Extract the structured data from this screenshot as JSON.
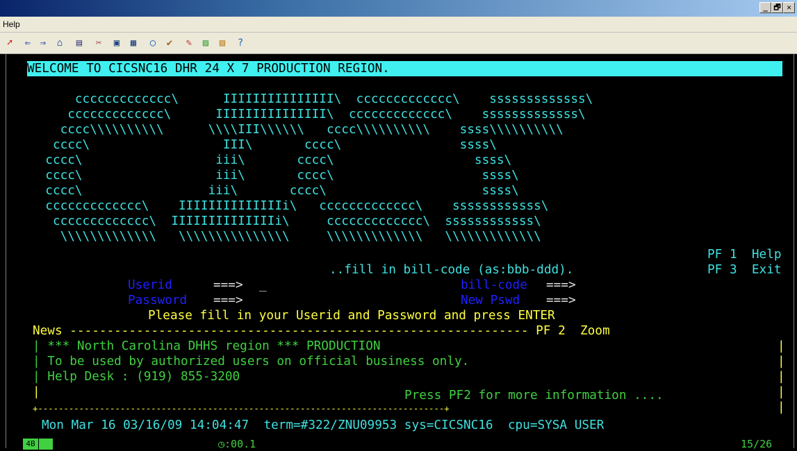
{
  "window": {
    "controls": [
      "_",
      "🗗",
      "✕"
    ]
  },
  "menu": {
    "help_label": "Help"
  },
  "toolbar": {
    "icons": [
      "connect-icon",
      "back-icon",
      "forward-icon",
      "home-icon",
      "open-icon",
      "tools-icon",
      "copy-icon",
      "print-preview-icon",
      "record-icon",
      "macro-icon",
      "edit-icon",
      "chart-icon",
      "chart2-icon",
      "help-icon"
    ]
  },
  "screen": {
    "banner": "WELCOME TO CICSNC16 DHR 24 X 7 PRODUCTION REGION.",
    "logo_lines": [
      "      ccccccccccccc\\      IIIIIIIIIIIIIII\\  ccccccccccccc\\    sssssssssssss\\",
      "     ccccccccccccc\\      IIIIIIIIIIIIIII\\  ccccccccccccc\\    sssssssssssss\\",
      "    cccc\\\\\\\\\\\\\\\\\\\\      \\\\\\\\III\\\\\\\\\\\\   cccc\\\\\\\\\\\\\\\\\\\\    ssss\\\\\\\\\\\\\\\\\\\\",
      "   cccc\\                  III\\       cccc\\                ssss\\",
      "  cccc\\                  iii\\       cccc\\                   ssss\\",
      "  cccc\\                  iii\\       cccc\\                    ssss\\",
      "  cccc\\                 iii\\       cccc\\                     ssss\\",
      "  ccccccccccccc\\    IIIIIIIIIIIIIIi\\   ccccccccccccc\\    ssssssssssss\\",
      "   ccccccccccccc\\  IIIIIIIIIIIIIIi\\     ccccccccccccc\\  ssssssssssss\\",
      "    \\\\\\\\\\\\\\\\\\\\\\\\\\   \\\\\\\\\\\\\\\\\\\\\\\\\\\\\\     \\\\\\\\\\\\\\\\\\\\\\\\\\   \\\\\\\\\\\\\\\\\\\\\\\\\\"
    ],
    "pf1": "PF 1  Help",
    "pf3": "PF 3  Exit",
    "bill_hint": "..fill in bill-code (as:bbb-ddd).",
    "userid_label": "Userid",
    "userid_arrow": "===>",
    "userid_value": "_",
    "password_label": "Password",
    "password_arrow": "===>",
    "billcode_label": "bill-code",
    "billcode_arrow": "===>",
    "newpswd_label": "New Pswd",
    "newpswd_arrow": "===>",
    "instruction": "Please fill in your Userid and Password and press ENTER",
    "news_header": "News -------------------------------------------------------------- PF 2  Zoom",
    "news_lines": [
      "| *** North Carolina DHHS region *** PRODUCTION",
      "| To be used by authorized users on official business only.",
      "| Help Desk : (919) 855-3200",
      "|"
    ],
    "news_more": "Press PF2 for more information ....",
    "news_right_bars": [
      "|",
      "|",
      "|",
      "|",
      "|"
    ],
    "news_footer": "+-------------------------------------------------------------------------------+",
    "sysinfo": "Mon Mar 16 03/16/09 14:04:47  term=#322/ZNU09953 sys=CICSNC16  cpu=SYSA USER"
  },
  "statusbar": {
    "mode": "4B",
    "timer": "◷:00.1",
    "cursor": "15/26"
  },
  "colors": {
    "cyan": "#40e0e0",
    "yellow": "#ffff40",
    "green": "#40d040",
    "blue": "#2020ff",
    "banner_bg": "#40f0f0"
  }
}
